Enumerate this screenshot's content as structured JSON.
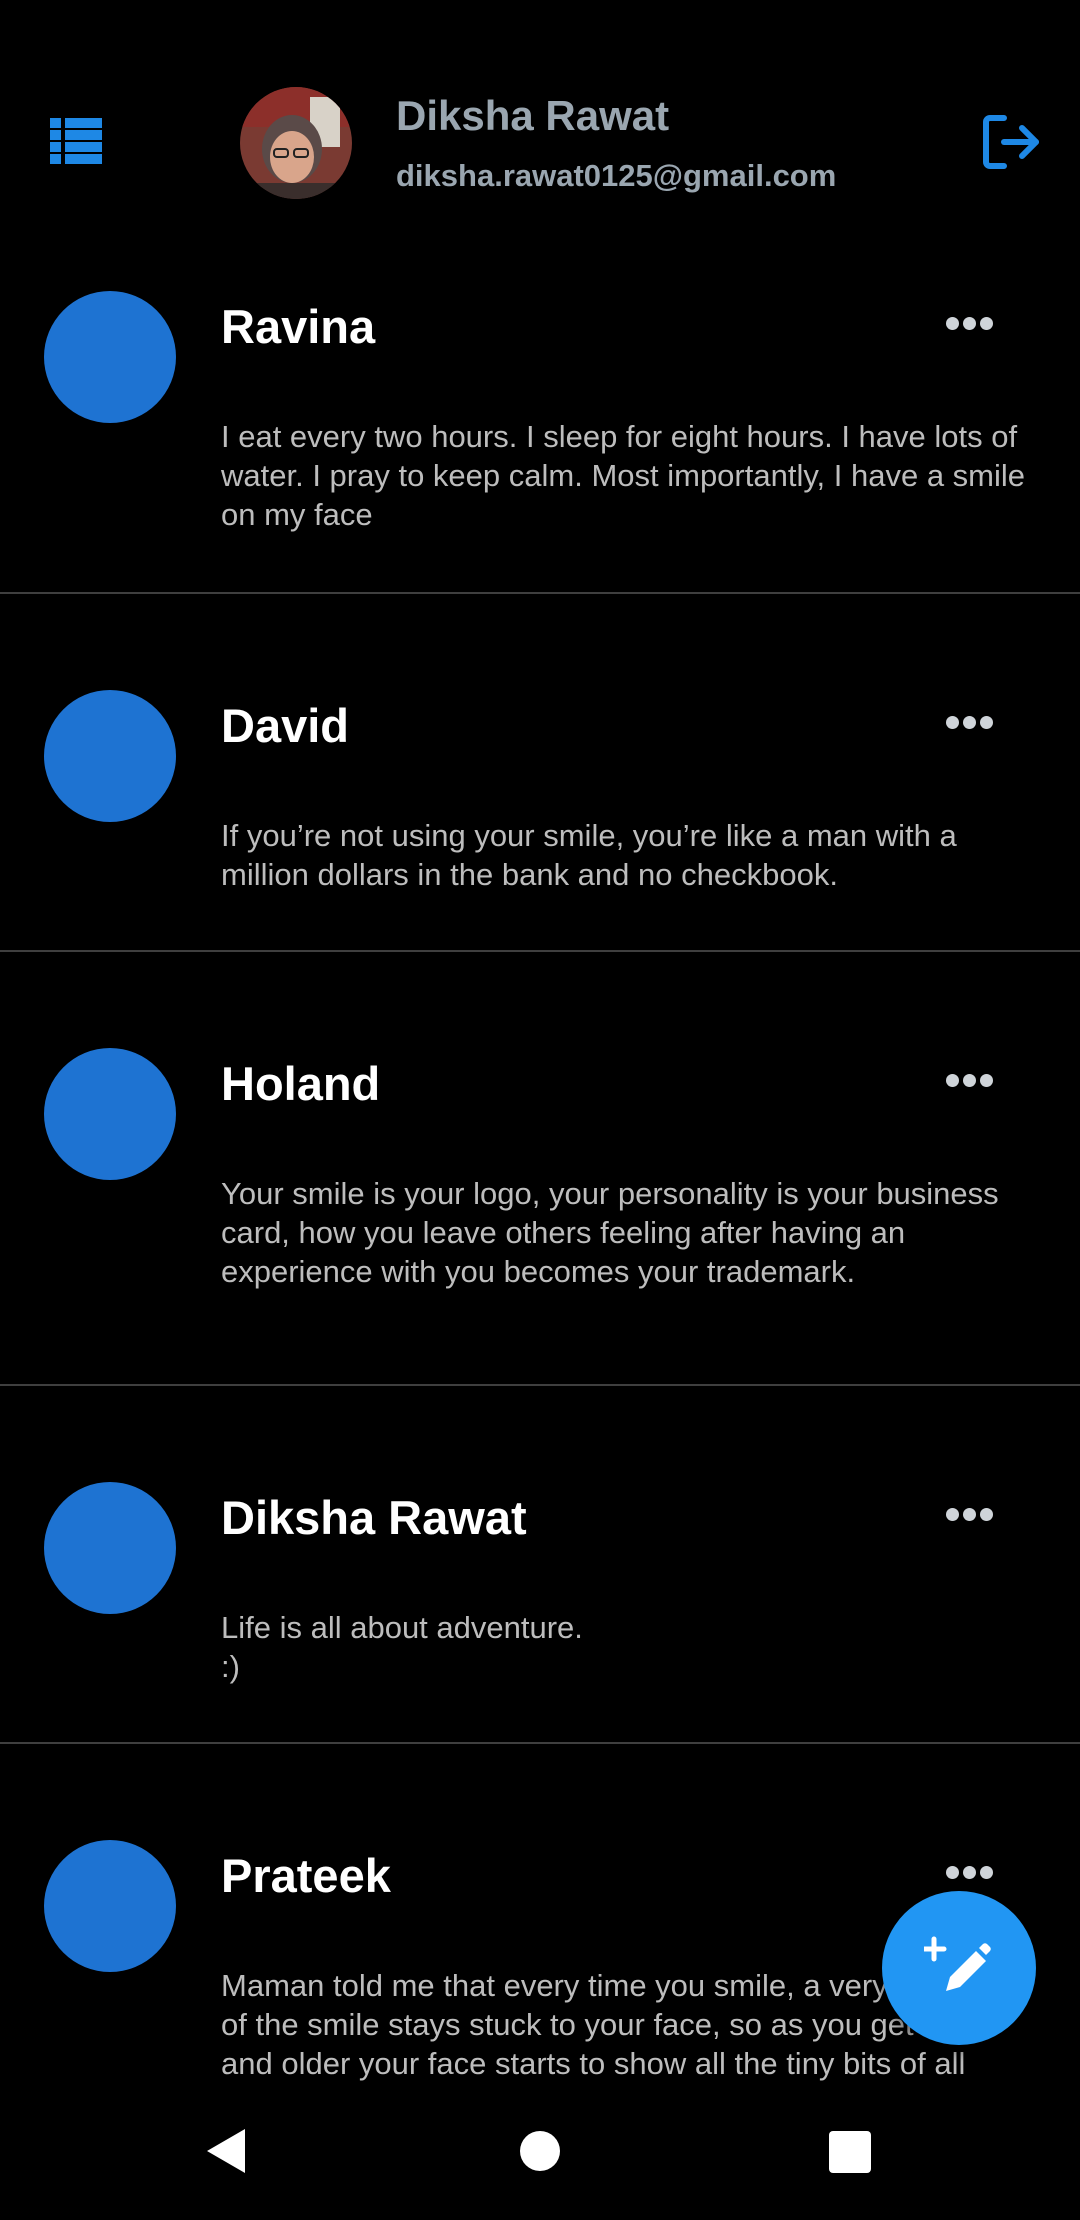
{
  "header": {
    "user_name": "Diksha Rawat",
    "user_email": "diksha.rawat0125@gmail.com",
    "menu_icon": "list-icon",
    "logout_icon": "logout-icon"
  },
  "colors": {
    "accent": "#1e73d2",
    "fab": "#2196f3",
    "background": "#000000"
  },
  "posts": [
    {
      "author": "Ravina",
      "text": "I eat every two hours. I sleep for eight hours. I have lots of water. I pray to keep calm. Most importantly, I have a smile on my face"
    },
    {
      "author": "David",
      "text": "If you’re not using your smile, you’re like a man with a million dollars in the bank and no checkbook."
    },
    {
      "author": "Holand",
      "text": "Your smile is your logo, your personality is your business card, how you leave others feeling after having an experience with you becomes your trademark."
    },
    {
      "author": "Diksha Rawat",
      "text": "Life is all about adventure.                                             :)"
    },
    {
      "author": "Prateek",
      "text": "Maman told me that every time you smile, a very small bit of the smile stays stuck to your face, so as you get older and older your face starts to show all the tiny bits of all your smiles and you look like your own smile really."
    }
  ],
  "fab": {
    "icon": "edit-icon"
  },
  "navbar": {
    "back_icon": "back-icon",
    "home_icon": "home-icon",
    "recents_icon": "recents-icon"
  }
}
